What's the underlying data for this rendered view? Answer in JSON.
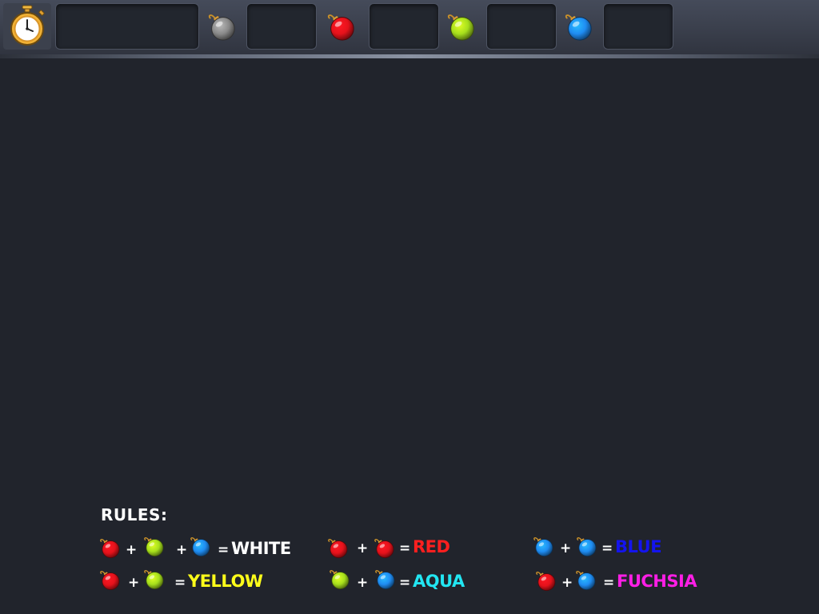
{
  "hud": {
    "timer": {
      "icon": "stopwatch-icon",
      "value": ""
    },
    "counters": [
      {
        "icon": "gray-ball-icon",
        "color": "#8a8a8a",
        "value": ""
      },
      {
        "icon": "red-ball-icon",
        "color": "#e5121b",
        "value": ""
      },
      {
        "icon": "green-ball-icon",
        "color": "#a6df1c",
        "value": ""
      },
      {
        "icon": "blue-ball-icon",
        "color": "#1f8cf2",
        "value": ""
      }
    ]
  },
  "rules": {
    "title": "RULES:",
    "plus": "+",
    "equals": "=",
    "items": [
      {
        "inputs": [
          "red",
          "green",
          "blue"
        ],
        "result": "WHITE",
        "result_color": "#ffffff"
      },
      {
        "inputs": [
          "red",
          "red"
        ],
        "result": "RED",
        "result_color": "#ff1f1f"
      },
      {
        "inputs": [
          "blue",
          "blue"
        ],
        "result": "BLUE",
        "result_color": "#1414ee"
      },
      {
        "inputs": [
          "red",
          "green"
        ],
        "result": "YELLOW",
        "result_color": "#ffff1a"
      },
      {
        "inputs": [
          "green",
          "blue"
        ],
        "result": "AQUA",
        "result_color": "#22e6f2"
      },
      {
        "inputs": [
          "red",
          "blue"
        ],
        "result": "FUCHSIA",
        "result_color": "#ff1ee6"
      }
    ]
  },
  "palette": {
    "red": "#e5121b",
    "green": "#a6df1c",
    "blue": "#1f8cf2",
    "gray": "#8a8a8a",
    "background": "#21242c"
  }
}
